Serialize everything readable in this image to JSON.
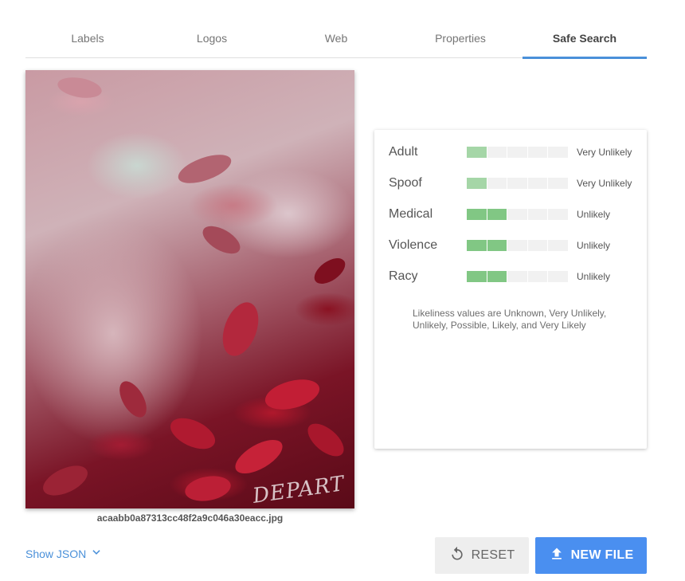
{
  "tabs": [
    {
      "label": "Labels",
      "active": false
    },
    {
      "label": "Logos",
      "active": false
    },
    {
      "label": "Web",
      "active": false
    },
    {
      "label": "Properties",
      "active": false
    },
    {
      "label": "Safe Search",
      "active": true
    }
  ],
  "image": {
    "filename": "acaabb0a87313cc48f2a9c046a30eacc.jpg",
    "watermark": "DEPART"
  },
  "safe_search": {
    "scale_segments": 5,
    "rows": [
      {
        "label": "Adult",
        "value": "Very Unlikely",
        "level": 1
      },
      {
        "label": "Spoof",
        "value": "Very Unlikely",
        "level": 1
      },
      {
        "label": "Medical",
        "value": "Unlikely",
        "level": 2
      },
      {
        "label": "Violence",
        "value": "Unlikely",
        "level": 2
      },
      {
        "label": "Racy",
        "value": "Unlikely",
        "level": 2
      }
    ],
    "note": "Likeliness values are Unknown, Very Unlikely, Unlikely, Possible, Likely, and Very Likely"
  },
  "footer": {
    "show_json_label": "Show JSON",
    "reset_label": "RESET",
    "new_file_label": "NEW FILE"
  },
  "colors": {
    "accent": "#4a90d9",
    "new_file_button": "#4a8ff0",
    "bar_level_1": "#a5d6a7",
    "bar_level_2": "#81c784",
    "bar_empty": "#f1f1f1"
  },
  "icons": {
    "show_json": "chevron-down-icon",
    "reset": "reset-icon",
    "new_file": "upload-icon"
  }
}
